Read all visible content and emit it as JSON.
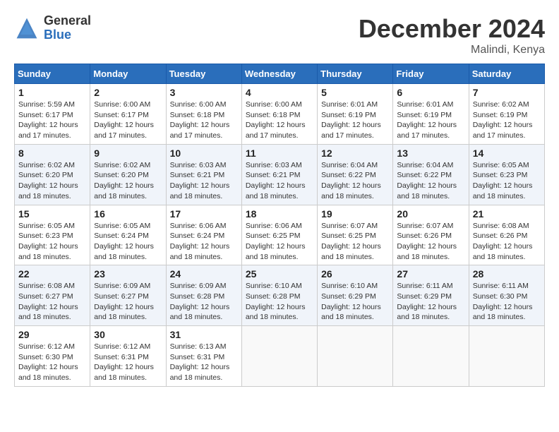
{
  "header": {
    "logo_general": "General",
    "logo_blue": "Blue",
    "month_title": "December 2024",
    "location": "Malindi, Kenya"
  },
  "days_of_week": [
    "Sunday",
    "Monday",
    "Tuesday",
    "Wednesday",
    "Thursday",
    "Friday",
    "Saturday"
  ],
  "weeks": [
    [
      {
        "day": "1",
        "sunrise": "Sunrise: 5:59 AM",
        "sunset": "Sunset: 6:17 PM",
        "daylight": "Daylight: 12 hours and 17 minutes."
      },
      {
        "day": "2",
        "sunrise": "Sunrise: 6:00 AM",
        "sunset": "Sunset: 6:17 PM",
        "daylight": "Daylight: 12 hours and 17 minutes."
      },
      {
        "day": "3",
        "sunrise": "Sunrise: 6:00 AM",
        "sunset": "Sunset: 6:18 PM",
        "daylight": "Daylight: 12 hours and 17 minutes."
      },
      {
        "day": "4",
        "sunrise": "Sunrise: 6:00 AM",
        "sunset": "Sunset: 6:18 PM",
        "daylight": "Daylight: 12 hours and 17 minutes."
      },
      {
        "day": "5",
        "sunrise": "Sunrise: 6:01 AM",
        "sunset": "Sunset: 6:19 PM",
        "daylight": "Daylight: 12 hours and 17 minutes."
      },
      {
        "day": "6",
        "sunrise": "Sunrise: 6:01 AM",
        "sunset": "Sunset: 6:19 PM",
        "daylight": "Daylight: 12 hours and 17 minutes."
      },
      {
        "day": "7",
        "sunrise": "Sunrise: 6:02 AM",
        "sunset": "Sunset: 6:19 PM",
        "daylight": "Daylight: 12 hours and 17 minutes."
      }
    ],
    [
      {
        "day": "8",
        "sunrise": "Sunrise: 6:02 AM",
        "sunset": "Sunset: 6:20 PM",
        "daylight": "Daylight: 12 hours and 18 minutes."
      },
      {
        "day": "9",
        "sunrise": "Sunrise: 6:02 AM",
        "sunset": "Sunset: 6:20 PM",
        "daylight": "Daylight: 12 hours and 18 minutes."
      },
      {
        "day": "10",
        "sunrise": "Sunrise: 6:03 AM",
        "sunset": "Sunset: 6:21 PM",
        "daylight": "Daylight: 12 hours and 18 minutes."
      },
      {
        "day": "11",
        "sunrise": "Sunrise: 6:03 AM",
        "sunset": "Sunset: 6:21 PM",
        "daylight": "Daylight: 12 hours and 18 minutes."
      },
      {
        "day": "12",
        "sunrise": "Sunrise: 6:04 AM",
        "sunset": "Sunset: 6:22 PM",
        "daylight": "Daylight: 12 hours and 18 minutes."
      },
      {
        "day": "13",
        "sunrise": "Sunrise: 6:04 AM",
        "sunset": "Sunset: 6:22 PM",
        "daylight": "Daylight: 12 hours and 18 minutes."
      },
      {
        "day": "14",
        "sunrise": "Sunrise: 6:05 AM",
        "sunset": "Sunset: 6:23 PM",
        "daylight": "Daylight: 12 hours and 18 minutes."
      }
    ],
    [
      {
        "day": "15",
        "sunrise": "Sunrise: 6:05 AM",
        "sunset": "Sunset: 6:23 PM",
        "daylight": "Daylight: 12 hours and 18 minutes."
      },
      {
        "day": "16",
        "sunrise": "Sunrise: 6:05 AM",
        "sunset": "Sunset: 6:24 PM",
        "daylight": "Daylight: 12 hours and 18 minutes."
      },
      {
        "day": "17",
        "sunrise": "Sunrise: 6:06 AM",
        "sunset": "Sunset: 6:24 PM",
        "daylight": "Daylight: 12 hours and 18 minutes."
      },
      {
        "day": "18",
        "sunrise": "Sunrise: 6:06 AM",
        "sunset": "Sunset: 6:25 PM",
        "daylight": "Daylight: 12 hours and 18 minutes."
      },
      {
        "day": "19",
        "sunrise": "Sunrise: 6:07 AM",
        "sunset": "Sunset: 6:25 PM",
        "daylight": "Daylight: 12 hours and 18 minutes."
      },
      {
        "day": "20",
        "sunrise": "Sunrise: 6:07 AM",
        "sunset": "Sunset: 6:26 PM",
        "daylight": "Daylight: 12 hours and 18 minutes."
      },
      {
        "day": "21",
        "sunrise": "Sunrise: 6:08 AM",
        "sunset": "Sunset: 6:26 PM",
        "daylight": "Daylight: 12 hours and 18 minutes."
      }
    ],
    [
      {
        "day": "22",
        "sunrise": "Sunrise: 6:08 AM",
        "sunset": "Sunset: 6:27 PM",
        "daylight": "Daylight: 12 hours and 18 minutes."
      },
      {
        "day": "23",
        "sunrise": "Sunrise: 6:09 AM",
        "sunset": "Sunset: 6:27 PM",
        "daylight": "Daylight: 12 hours and 18 minutes."
      },
      {
        "day": "24",
        "sunrise": "Sunrise: 6:09 AM",
        "sunset": "Sunset: 6:28 PM",
        "daylight": "Daylight: 12 hours and 18 minutes."
      },
      {
        "day": "25",
        "sunrise": "Sunrise: 6:10 AM",
        "sunset": "Sunset: 6:28 PM",
        "daylight": "Daylight: 12 hours and 18 minutes."
      },
      {
        "day": "26",
        "sunrise": "Sunrise: 6:10 AM",
        "sunset": "Sunset: 6:29 PM",
        "daylight": "Daylight: 12 hours and 18 minutes."
      },
      {
        "day": "27",
        "sunrise": "Sunrise: 6:11 AM",
        "sunset": "Sunset: 6:29 PM",
        "daylight": "Daylight: 12 hours and 18 minutes."
      },
      {
        "day": "28",
        "sunrise": "Sunrise: 6:11 AM",
        "sunset": "Sunset: 6:30 PM",
        "daylight": "Daylight: 12 hours and 18 minutes."
      }
    ],
    [
      {
        "day": "29",
        "sunrise": "Sunrise: 6:12 AM",
        "sunset": "Sunset: 6:30 PM",
        "daylight": "Daylight: 12 hours and 18 minutes."
      },
      {
        "day": "30",
        "sunrise": "Sunrise: 6:12 AM",
        "sunset": "Sunset: 6:31 PM",
        "daylight": "Daylight: 12 hours and 18 minutes."
      },
      {
        "day": "31",
        "sunrise": "Sunrise: 6:13 AM",
        "sunset": "Sunset: 6:31 PM",
        "daylight": "Daylight: 12 hours and 18 minutes."
      },
      null,
      null,
      null,
      null
    ]
  ]
}
